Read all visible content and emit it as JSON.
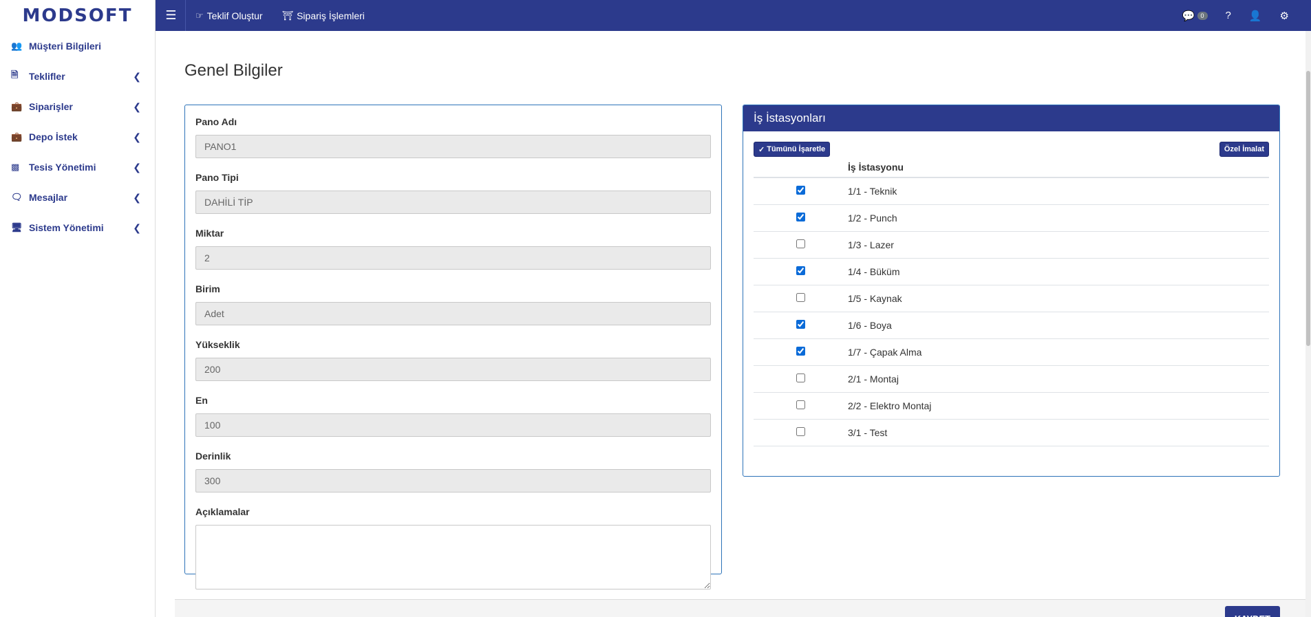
{
  "brand": {
    "name": "MODSOFT"
  },
  "topnav": {
    "items": [
      {
        "icon": "handshake-icon",
        "label": "Teklif Oluştur"
      },
      {
        "icon": "basket-icon",
        "label": "Sipariş İşlemleri"
      }
    ],
    "right": {
      "messages_count": "0",
      "help": "?"
    }
  },
  "sidebar": {
    "items": [
      {
        "icon": "users-icon",
        "label": "Müşteri Bilgileri",
        "has_chevron": false
      },
      {
        "icon": "file-icon",
        "label": "Teklifler",
        "has_chevron": true
      },
      {
        "icon": "briefcase-icon",
        "label": "Siparişler",
        "has_chevron": true
      },
      {
        "icon": "briefcase-icon",
        "label": "Depo İstek",
        "has_chevron": true
      },
      {
        "icon": "industry-icon",
        "label": "Tesis Yönetimi",
        "has_chevron": true
      },
      {
        "icon": "comments-icon",
        "label": "Mesajlar",
        "has_chevron": true
      },
      {
        "icon": "desktop-icon",
        "label": "Sistem Yönetimi",
        "has_chevron": true
      }
    ]
  },
  "page": {
    "title": "Genel Bilgiler"
  },
  "form": {
    "fields": [
      {
        "label": "Pano Adı",
        "value": "PANO1"
      },
      {
        "label": "Pano Tipi",
        "value": "DAHİLİ TİP"
      },
      {
        "label": "Miktar",
        "value": "2"
      },
      {
        "label": "Birim",
        "value": "Adet"
      },
      {
        "label": "Yükseklik",
        "value": "200"
      },
      {
        "label": "En",
        "value": "100"
      },
      {
        "label": "Derinlik",
        "value": "300"
      }
    ],
    "notes_label": "Açıklamalar",
    "notes_value": ""
  },
  "workstations": {
    "title": "İş İstasyonları",
    "select_all_label": "Tümünü İşaretle",
    "custom_label": "Özel İmalat",
    "column_header": "İş İstasyonu",
    "rows": [
      {
        "name": "1/1 - Teknik",
        "checked": true
      },
      {
        "name": "1/2 - Punch",
        "checked": true
      },
      {
        "name": "1/3 - Lazer",
        "checked": false
      },
      {
        "name": "1/4 - Büküm",
        "checked": true
      },
      {
        "name": "1/5 - Kaynak",
        "checked": false
      },
      {
        "name": "1/6 - Boya",
        "checked": true
      },
      {
        "name": "1/7 - Çapak Alma",
        "checked": true
      },
      {
        "name": "2/1 - Montaj",
        "checked": false
      },
      {
        "name": "2/2 - Elektro Montaj",
        "checked": false
      },
      {
        "name": "3/1 - Test",
        "checked": false
      }
    ]
  },
  "footer": {
    "save_label": "KAYDET"
  },
  "colors": {
    "primary": "#2c3a8c",
    "border_blue": "#2c72b8",
    "checkbox": "#0b6bd8"
  }
}
